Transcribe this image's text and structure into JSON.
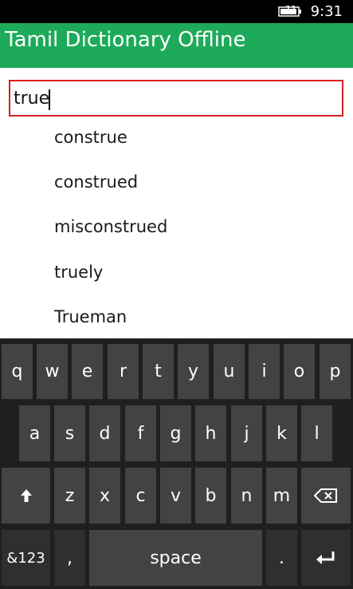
{
  "status": {
    "time": "9:31"
  },
  "app": {
    "title": "Tamil Dictionary Offline"
  },
  "search": {
    "value": "true",
    "placeholder": ""
  },
  "suggestions": [
    "construe",
    "construed",
    "misconstrued",
    "truely",
    "Trueman"
  ],
  "keyboard": {
    "row1": [
      "q",
      "w",
      "e",
      "r",
      "t",
      "y",
      "u",
      "i",
      "o",
      "p"
    ],
    "row2": [
      "a",
      "s",
      "d",
      "f",
      "g",
      "h",
      "j",
      "k",
      "l"
    ],
    "row3": [
      "z",
      "x",
      "c",
      "v",
      "b",
      "n",
      "m"
    ],
    "symbols_label": "&123",
    "comma_label": ",",
    "space_label": "space",
    "period_label": ".",
    "icons": {
      "shift": "shift-up-arrow-icon",
      "backspace": "backspace-icon",
      "enter": "enter-return-icon"
    }
  },
  "colors": {
    "header": "#1daa5a",
    "search_border": "#d81e1e",
    "keyboard_bg": "#1f1f1f",
    "key": "#434343"
  }
}
